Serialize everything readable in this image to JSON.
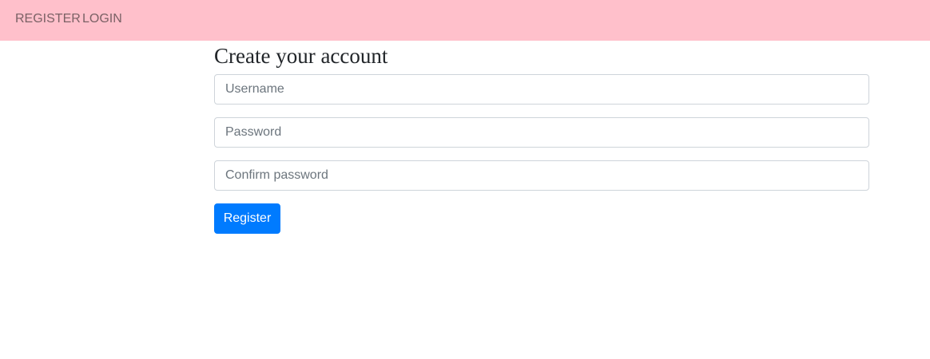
{
  "nav": {
    "register_label": "REGISTER",
    "login_label": "LOGIN"
  },
  "form": {
    "title": "Create your account",
    "username": {
      "placeholder": "Username",
      "value": ""
    },
    "password": {
      "placeholder": "Password",
      "value": ""
    },
    "confirm_password": {
      "placeholder": "Confirm password",
      "value": ""
    },
    "submit_label": "Register"
  },
  "colors": {
    "navbar_background": "#ffc0cb",
    "nav_link_text": "#7a6165",
    "primary_button": "#007bff",
    "input_border": "#ced4da"
  }
}
